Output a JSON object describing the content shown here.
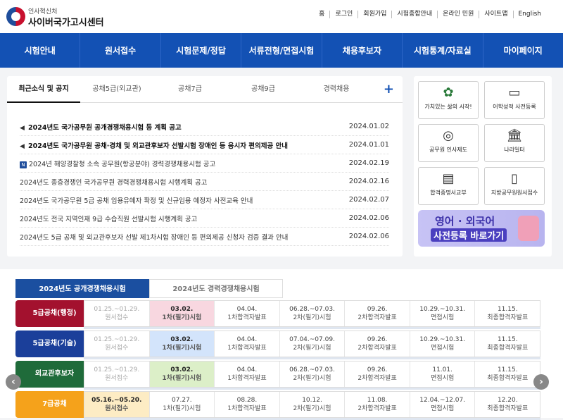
{
  "header": {
    "logo_small": "인사혁신처",
    "logo_big": "사이버국가고시센터",
    "util": [
      "홈",
      "로그인",
      "회원가입",
      "시험종합안내",
      "온라인 민원",
      "사이트맵",
      "English"
    ]
  },
  "gnb": [
    "시험안내",
    "원서접수",
    "시험문제/정답",
    "서류전형/면접시험",
    "채용후보자",
    "시험통계/자료실",
    "마이페이지"
  ],
  "news": {
    "tabs": [
      "최근소식 및 공지",
      "공채5급(외교관)",
      "공채7급",
      "공채9급",
      "경력채용"
    ],
    "plus": "+",
    "items": [
      {
        "title": "2024년도 국가공무원 공개경쟁채용시험 등 계획 공고",
        "date": "2024.01.02",
        "bold": true,
        "icon": "speaker-icon"
      },
      {
        "title": "2024년도 국가공무원 공채·경채 및 외교관후보자 선발시험 장애인 등 응시자 편의제공 안내",
        "date": "2024.01.01",
        "bold": true,
        "icon": "speaker-icon"
      },
      {
        "title": "2024년 해양경찰청 소속 공무원(항공분야) 경력경쟁채용시험 공고",
        "date": "2024.02.19",
        "bold": false,
        "icon": "new-icon"
      },
      {
        "title": "2024년도 종층경쟁인 국가공무원 경력경쟁채용시험 시행계획 공고",
        "date": "2024.02.16",
        "bold": false,
        "icon": ""
      },
      {
        "title": "2024년도 국가공무원 5급 공채 임용유예자 확정 및 신규임용 예정자 사전교육 안내",
        "date": "2024.02.07",
        "bold": false,
        "icon": ""
      },
      {
        "title": "2024년도 전국 지역인재 9급 수습직원 선발시험 시행계획 공고",
        "date": "2024.02.06",
        "bold": false,
        "icon": ""
      },
      {
        "title": "2024년도 5급 공채 및 외교관후보자 선발 제1차시험 장애인 등 편의제공 신청자 검증 결과 안내",
        "date": "2024.02.06",
        "bold": false,
        "icon": ""
      }
    ]
  },
  "quick": [
    {
      "label": "가치있는 삶의 시작!",
      "icon": "slogan-icon"
    },
    {
      "label": "어학성적 사전등록",
      "icon": "monitor-icon"
    },
    {
      "label": "공무원 인사제도",
      "icon": "globe-icon"
    },
    {
      "label": "나라일터",
      "icon": "building-icon"
    },
    {
      "label": "합격증명서교부",
      "icon": "certificate-icon"
    },
    {
      "label": "지방공무원원서접수",
      "icon": "document-icon"
    }
  ],
  "banner": {
    "line1": "영어 · 외국어",
    "line2": "사전등록 바로가기"
  },
  "schedule": {
    "tabs": [
      "2024년도 공개경쟁채용시험",
      "2024년도 경력경쟁채용시험"
    ],
    "rows": [
      {
        "name": "5급공채(행정)",
        "color": "#a3112e",
        "cells": [
          [
            "01.25.~01.29.",
            "원서접수"
          ],
          [
            "03.02.",
            "1차(필기)시험"
          ],
          [
            "04.04.",
            "1차합격자발표"
          ],
          [
            "06.28.~07.03.",
            "2차(필기)시험"
          ],
          [
            "09.26.",
            "2차합격자발표"
          ],
          [
            "10.29.~10.31.",
            "면접시험"
          ],
          [
            "11.15.",
            "최종합격자발표"
          ]
        ]
      },
      {
        "name": "5급공채(기술)",
        "color": "#1b3f9a",
        "cells": [
          [
            "01.25.~01.29.",
            "원서접수"
          ],
          [
            "03.02.",
            "1차(필기)시험"
          ],
          [
            "04.04.",
            "1차합격자발표"
          ],
          [
            "07.04.~07.09.",
            "2차(필기)시험"
          ],
          [
            "09.26.",
            "2차합격자발표"
          ],
          [
            "10.29.~10.31.",
            "면접시험"
          ],
          [
            "11.15.",
            "최종합격자발표"
          ]
        ]
      },
      {
        "name": "외교관후보자",
        "color": "#1f6b3a",
        "cells": [
          [
            "01.25.~01.29.",
            "원서접수"
          ],
          [
            "03.02.",
            "1차(필기)시험"
          ],
          [
            "04.04.",
            "1차합격자발표"
          ],
          [
            "06.28.~07.03.",
            "2차(필기)시험"
          ],
          [
            "09.26.",
            "2차합격자발표"
          ],
          [
            "11.01.",
            "면접시험"
          ],
          [
            "11.15.",
            "최종합격자발표"
          ]
        ]
      },
      {
        "name": "7급공채",
        "color": "#f5a21b",
        "cells": [
          [
            "05.16.~05.20.",
            "원서접수"
          ],
          [
            "07.27.",
            "1차(필기)시험"
          ],
          [
            "08.28.",
            "1차합격자발표"
          ],
          [
            "10.12.",
            "2차(필기)시험"
          ],
          [
            "11.08.",
            "2차합격자발표"
          ],
          [
            "12.04.~12.07.",
            "면접시험"
          ],
          [
            "12.20.",
            "최종합격자발표"
          ]
        ]
      }
    ]
  }
}
